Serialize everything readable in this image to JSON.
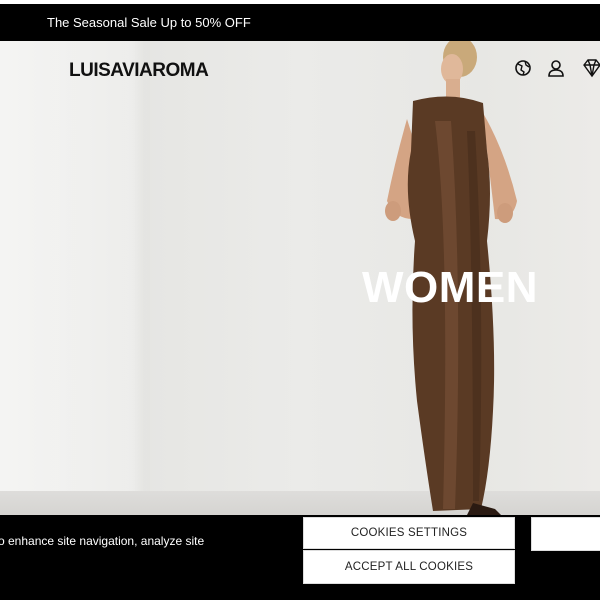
{
  "topbar": {
    "promo": "The Seasonal Sale Up to 50% OFF"
  },
  "header": {
    "logo": "LUISAVIAROMA",
    "icons": [
      "globe-icon",
      "user-icon",
      "diamond-icon"
    ]
  },
  "hero": {
    "title": "WOMEN"
  },
  "cookie_banner": {
    "text": "o enhance site navigation, analyze site",
    "settings_label": "COOKIES SETTINGS",
    "accept_label": "ACCEPT ALL COOKIES",
    "reject_label": ""
  }
}
